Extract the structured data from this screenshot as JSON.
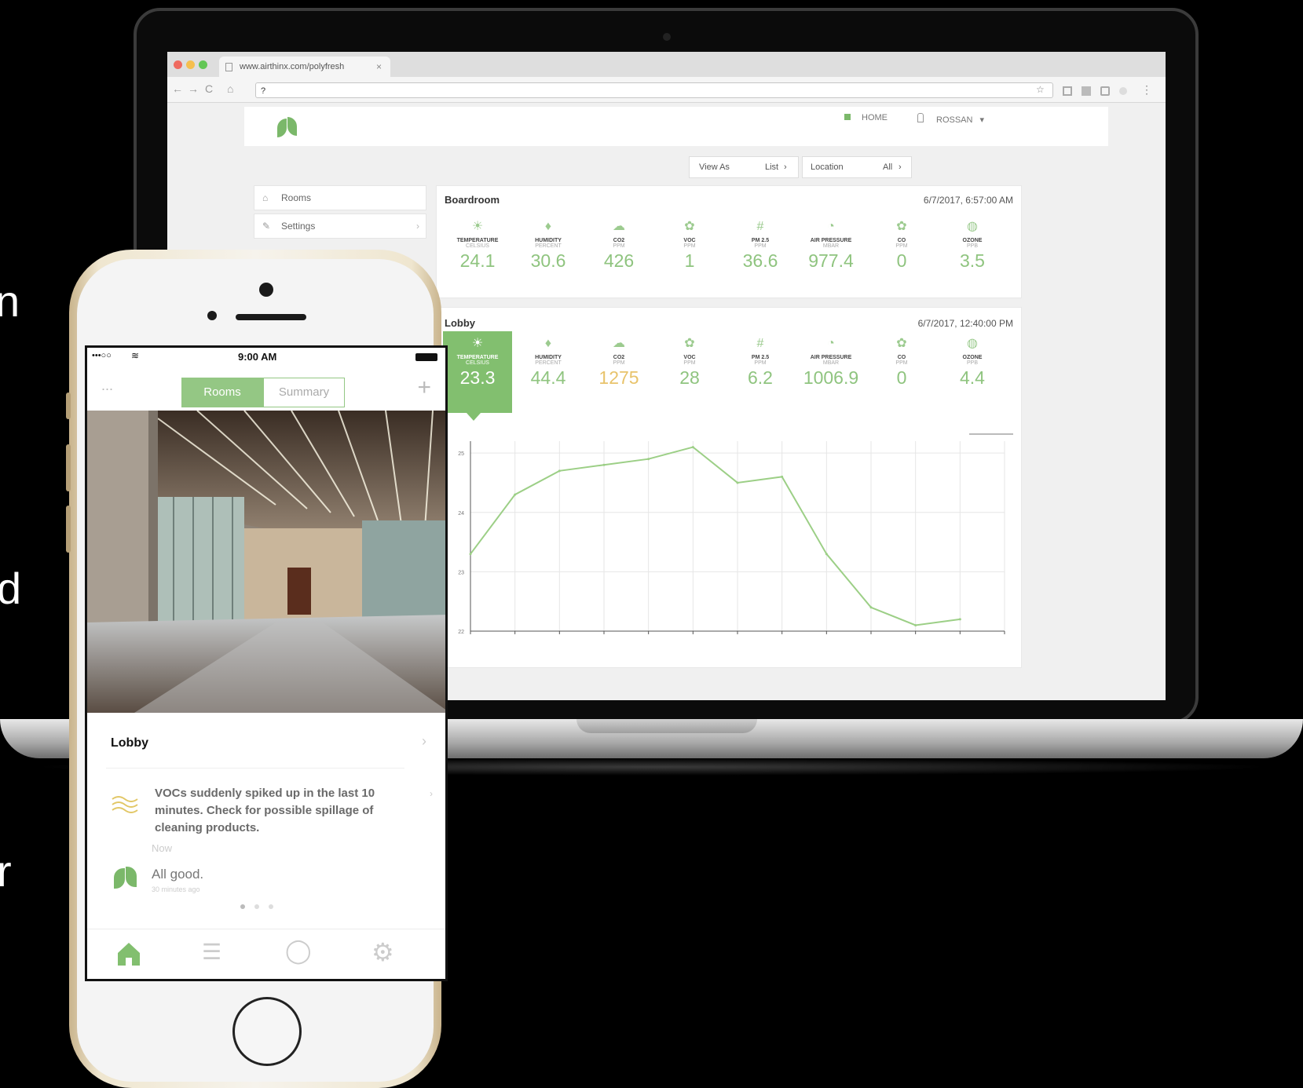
{
  "edge_text": [
    "n",
    "d",
    "r"
  ],
  "browser": {
    "tab_title": "www.airthinx.com/polyfresh",
    "close_glyph": "×",
    "address": "?",
    "back": "←",
    "forward": "→",
    "reload": "C",
    "home_glyph": "⌂",
    "star_glyph": "☆",
    "menu_glyph": "⋮"
  },
  "app": {
    "nav_home": "HOME",
    "user_name": "ROSSAN",
    "user_caret": "▾",
    "view_as_label": "View As",
    "view_as_value": "List",
    "location_label": "Location",
    "location_value": "All",
    "sidebar": [
      {
        "icon": "home-icon",
        "glyph": "⌂",
        "label": "Rooms"
      },
      {
        "icon": "edit-icon",
        "glyph": "✎",
        "label": "Settings"
      }
    ]
  },
  "panels": [
    {
      "title": "Boardroom",
      "timestamp": "6/7/2017, 6:57:00 AM",
      "metrics": [
        {
          "icon": "sun-icon",
          "glyph": "☀",
          "name": "TEMPERATURE",
          "unit": "CELSIUS",
          "value": "24.1",
          "status": "good"
        },
        {
          "icon": "droplet-icon",
          "glyph": "♦",
          "name": "HUMIDITY",
          "unit": "PERCENT",
          "value": "30.6",
          "status": "good"
        },
        {
          "icon": "co2-icon",
          "glyph": "☁",
          "name": "CO2",
          "unit": "PPM",
          "value": "426",
          "status": "good"
        },
        {
          "icon": "voc-icon",
          "glyph": "✿",
          "name": "VOC",
          "unit": "PPM",
          "value": "1",
          "status": "good"
        },
        {
          "icon": "pm-icon",
          "glyph": "#",
          "name": "PM 2.5",
          "unit": "PPM",
          "value": "36.6",
          "status": "good"
        },
        {
          "icon": "gauge-icon",
          "glyph": "◔",
          "name": "AIR PRESSURE",
          "unit": "MBAR",
          "value": "977.4",
          "status": "good"
        },
        {
          "icon": "co-icon",
          "glyph": "✿",
          "name": "CO",
          "unit": "PPM",
          "value": "0",
          "status": "good"
        },
        {
          "icon": "ozone-icon",
          "glyph": "◍",
          "name": "OZONE",
          "unit": "PPB",
          "value": "3.5",
          "status": "good"
        }
      ]
    },
    {
      "title": "Lobby",
      "timestamp": "6/7/2017, 12:40:00 PM",
      "metrics": [
        {
          "icon": "sun-icon",
          "glyph": "☀",
          "name": "TEMPERATURE",
          "unit": "CELSIUS",
          "value": "23.3",
          "status": "active"
        },
        {
          "icon": "droplet-icon",
          "glyph": "♦",
          "name": "HUMIDITY",
          "unit": "PERCENT",
          "value": "44.4",
          "status": "good"
        },
        {
          "icon": "co2-icon",
          "glyph": "☁",
          "name": "CO2",
          "unit": "PPM",
          "value": "1275",
          "status": "warn"
        },
        {
          "icon": "voc-icon",
          "glyph": "✿",
          "name": "VOC",
          "unit": "PPM",
          "value": "28",
          "status": "good"
        },
        {
          "icon": "pm-icon",
          "glyph": "#",
          "name": "PM 2.5",
          "unit": "PPM",
          "value": "6.2",
          "status": "good"
        },
        {
          "icon": "gauge-icon",
          "glyph": "◔",
          "name": "AIR PRESSURE",
          "unit": "MBAR",
          "value": "1006.9",
          "status": "good"
        },
        {
          "icon": "co-icon",
          "glyph": "✿",
          "name": "CO",
          "unit": "PPM",
          "value": "0",
          "status": "good"
        },
        {
          "icon": "ozone-icon",
          "glyph": "◍",
          "name": "OZONE",
          "unit": "PPB",
          "value": "4.4",
          "status": "good"
        }
      ]
    }
  ],
  "chart_data": {
    "type": "line",
    "xlabel": "",
    "ylabel": "",
    "ylim": [
      22,
      25.2
    ],
    "yticks": [
      "22",
      "22.5",
      "23",
      "23.5",
      "24",
      "24.5",
      "25"
    ],
    "x": [
      0,
      0.5,
      1,
      1.5,
      2,
      2.5,
      3,
      3.5,
      4,
      4.5,
      5,
      5.5
    ],
    "values": [
      23.3,
      24.3,
      24.7,
      24.8,
      24.9,
      25.1,
      24.5,
      24.6,
      23.3,
      22.4,
      22.1,
      22.2
    ],
    "line_color": "#9ccf86",
    "grid": true,
    "legend": "top-right"
  },
  "phone": {
    "signal": "•••○○",
    "wifi_glyph": "≋",
    "time": "9:00 AM",
    "nav_left": "...",
    "tab_rooms": "Rooms",
    "tab_summary": "Summary",
    "add_glyph": "+",
    "room_title": "Lobby",
    "chevron": "›",
    "alert_text": "VOCs suddenly spiked up in the last 10 minutes. Check for possible spillage of cleaning products.",
    "alert_time": "Now",
    "status_text": "All good.",
    "status_time": "30 minutes ago",
    "tabs": [
      {
        "icon": "home-icon",
        "glyph": "⌂"
      },
      {
        "icon": "list-icon",
        "glyph": "☰"
      },
      {
        "icon": "chat-icon",
        "glyph": "◯"
      },
      {
        "icon": "gear-icon",
        "glyph": "⚙"
      }
    ]
  },
  "colors": {
    "accent": "#82bf6f",
    "warn": "#e8c36b",
    "text_muted": "#999999"
  }
}
